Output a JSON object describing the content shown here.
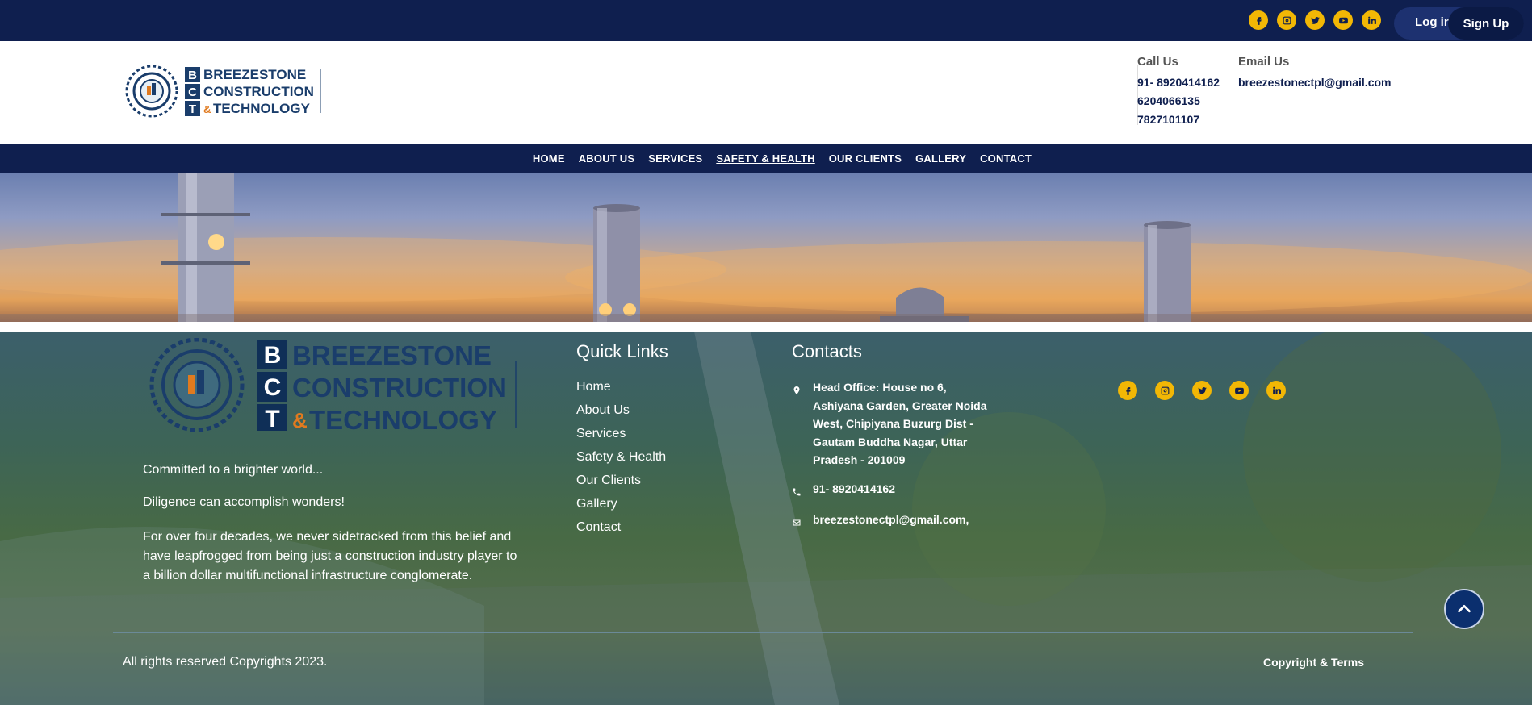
{
  "topbar": {
    "social_icons": [
      "facebook-icon",
      "instagram-icon",
      "twitter-icon",
      "youtube-icon",
      "linkedin-icon"
    ],
    "login_label": "Log in",
    "signup_label": "Sign Up"
  },
  "header": {
    "logo": {
      "b": "B",
      "c": "C",
      "t": "T",
      "line1": "BREEZESTONE",
      "line2": "CONSTRUCTION",
      "amp": "&",
      "line3": "TECHNOLOGY"
    },
    "call": {
      "label": "Call Us",
      "phones": [
        "91- 8920414162",
        "6204066135",
        "7827101107"
      ]
    },
    "email": {
      "label": "Email Us",
      "address": "breezestonectpl@gmail.com"
    }
  },
  "nav": {
    "items": [
      "HOME",
      "ABOUT US",
      "SERVICES",
      "SAFETY & HEALTH",
      "OUR CLIENTS",
      "GALLERY",
      "CONTACT"
    ],
    "active": "SAFETY & HEALTH"
  },
  "footer": {
    "logo": {
      "b": "B",
      "c": "C",
      "t": "T",
      "line1": "BREEZESTONE",
      "line2": "CONSTRUCTION",
      "amp": "&",
      "line3": "TECHNOLOGY"
    },
    "tagline1": "Committed to a brighter world...",
    "tagline2": "Diligence can accomplish wonders!",
    "about": "For over four decades, we never sidetracked from this belief and have leapfrogged from being just a construction industry player to a billion dollar multifunctional infrastructure conglomerate.",
    "quick_links": {
      "title": "Quick Links",
      "items": [
        "Home",
        "About Us",
        "Services",
        "Safety & Health",
        "Our Clients",
        "Gallery",
        "Contact"
      ]
    },
    "contacts": {
      "title": "Contacts",
      "address": "Head Office: House no 6, Ashiyana Garden, Greater Noida West, Chipiyana Buzurg Dist - Gautam Buddha Nagar, Uttar Pradesh - 201009",
      "phone": "91- 8920414162",
      "email": "breezestonectpl@gmail.com,"
    },
    "social_icons": [
      "facebook-icon",
      "instagram-icon",
      "twitter-icon",
      "youtube-icon",
      "linkedin-icon"
    ],
    "copyright": "All rights reserved Copyrights 2023.",
    "terms": "Copyright & Terms"
  },
  "colors": {
    "navy": "#0f1f4f",
    "accent_yellow": "#f2b705",
    "logo_orange": "#e07a1f"
  }
}
